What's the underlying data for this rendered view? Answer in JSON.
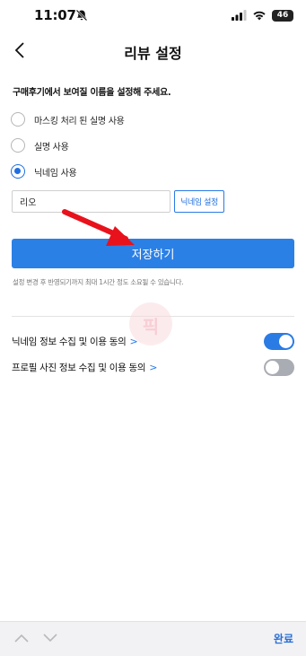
{
  "status_bar": {
    "time": "11:07",
    "battery": "46"
  },
  "nav": {
    "title": "리뷰 설정"
  },
  "instruction": "구매후기에서 보여질 이름을 설정해 주세요.",
  "options": [
    {
      "label": "마스킹 처리 된 실명 사용",
      "selected": false
    },
    {
      "label": "실명 사용",
      "selected": false
    },
    {
      "label": "닉네임 사용",
      "selected": true
    }
  ],
  "nickname": {
    "value": "리오",
    "button_label": "닉네임 설정"
  },
  "save": {
    "label": "저장하기",
    "notice": "설정 변경 후 반영되기까지 최대 1시간 정도 소요될 수 있습니다."
  },
  "watermark": "픽",
  "consents": [
    {
      "label": "닉네임 정보 수집 및 이용 동의",
      "chevron": ">",
      "enabled": true
    },
    {
      "label": "프로필 사진 정보 수집 및 이용 동의",
      "chevron": ">",
      "enabled": false
    }
  ],
  "keyboard_bar": {
    "done_label": "완료"
  },
  "colors": {
    "accent": "#2b80e6",
    "toggle_off": "#a9adb3",
    "arrow": "#e8121c"
  }
}
